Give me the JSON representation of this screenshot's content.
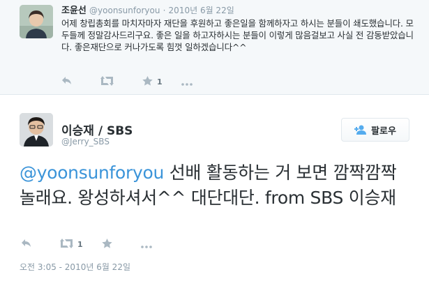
{
  "reply_tweet": {
    "name": "조윤선",
    "handle": "@yoonsunforyou",
    "date": "2010년 6월 22일",
    "text": "어제 창립총회를 마치자마자 재단을 후원하고 좋은일을 함께하자고 하시는 분들이 쇄도했습니다. 모두들께 정말감사드리구요. 좋은 일을 하고자하시는 분들이 이렇게 많음걸보고 사실 전 감동받았습니다. 좋은재단으로 커나가도록 힘껏 일하겠습니다^^",
    "favorite_count": "1"
  },
  "main_tweet": {
    "name": "이승재 / SBS",
    "handle": "@Jerry_SBS",
    "follow_label": "팔로우",
    "mention": "@yoonsunforyou",
    "text": " 선배 활동하는 거 보면 깜짝깜짝 놀래요. 왕성하셔서^^ 대단대단. from SBS 이승재",
    "retweet_count": "1",
    "timestamp": "오전 3:05 - 2010년 6월 22일"
  },
  "colors": {
    "link": "#3b94d9",
    "secondary_text": "#8899a6",
    "icon": "#aab8c2",
    "background_reply": "#f5f8fa"
  },
  "icons": [
    "reply-icon",
    "retweet-icon",
    "favorite-icon",
    "more-icon",
    "follow-person-icon"
  ]
}
